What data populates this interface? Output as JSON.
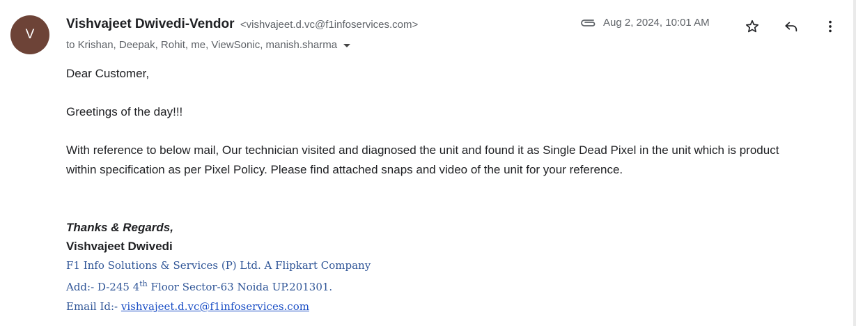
{
  "sender": {
    "avatar_letter": "V",
    "name": "Vishvajeet Dwivedi-Vendor",
    "email": "<vishvajeet.d.vc@f1infoservices.com>"
  },
  "recipients": "to Krishan, Deepak, Rohit, me, ViewSonic, manish.sharma",
  "date": "Aug 2, 2024, 10:01 AM",
  "icons": {
    "attachment": "paperclip-icon",
    "star": "star-icon",
    "reply": "reply-icon",
    "more": "more-vert-icon"
  },
  "body": {
    "greeting": "Dear Customer,",
    "line2": "Greetings of the day!!!",
    "para_line1": "With reference to below mail, Our technician visited and diagnosed the unit and found it as Single Dead Pixel in the unit which is product",
    "para_line2": "within specification as per Pixel Policy. Please find attached snaps and video of the unit for your reference."
  },
  "signature": {
    "regards": "Thanks & Regards,",
    "name": "Vishvajeet Dwivedi",
    "company": "F1 Info Solutions & Services (P) Ltd. A Flipkart Company",
    "address_prefix": "Add:- D-245 4",
    "address_sup": "th",
    "address_suffix": " Floor Sector-63 Noida UP.201301.",
    "email_label": "Email Id:- ",
    "email_link": "vishvajeet.d.vc@f1infoservices.com"
  },
  "colors": {
    "avatar_bg": "#6d4337",
    "signature_blue": "#2f5597",
    "link_blue": "#1a4ec5"
  }
}
